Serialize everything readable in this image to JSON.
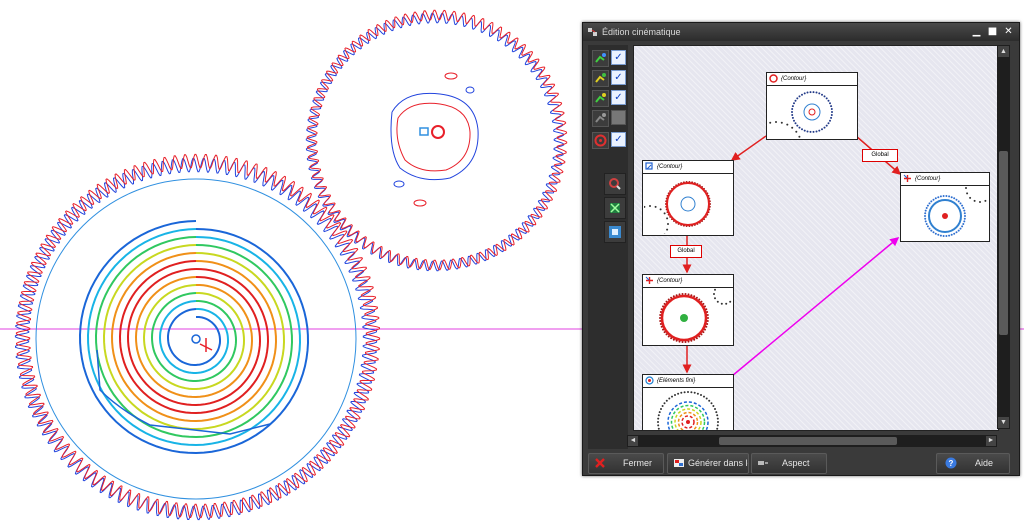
{
  "window": {
    "title": "Édition cinématique",
    "controls": {
      "minimize": "▁",
      "maximize": "■",
      "close": "✕"
    }
  },
  "sidebar": {
    "rows": [
      {
        "icon": "link-green-icon",
        "checked": true
      },
      {
        "icon": "link-yellow-icon",
        "checked": true
      },
      {
        "icon": "link-green-icon",
        "checked": true
      },
      {
        "icon": "link-grey-icon",
        "checked": false
      },
      {
        "icon": "gear-red-icon",
        "checked": true
      }
    ],
    "tools": [
      "zoom-icon",
      "fit-icon",
      "layout-icon"
    ],
    "check_glyph": "✓"
  },
  "graph": {
    "nodes": [
      {
        "id": "n1",
        "label": "{Contour}"
      },
      {
        "id": "n2",
        "label": "{Contour}"
      },
      {
        "id": "n3",
        "label": "{Contour}"
      },
      {
        "id": "n4",
        "label": "{Contour}"
      },
      {
        "id": "n5",
        "label": "{Eléments fini}"
      }
    ],
    "edge_labels": {
      "global_1": "Global",
      "global_2": "Global"
    },
    "colors": {
      "edge_red": "#e02020",
      "edge_magenta": "#ee00ee"
    }
  },
  "scrollbars": {
    "up": "▲",
    "down": "▼",
    "left": "◄",
    "right": "►"
  },
  "buttons": {
    "fermer": "Fermer",
    "generer": "Générer dans le",
    "aspect": "Aspect",
    "aide": "Aide"
  },
  "colors": {
    "gear_red": "#e8202a",
    "gear_blue": "#2244dd",
    "ring_blue": "#3090e0",
    "axis_magenta": "#e040e0",
    "spiral": [
      "#1a66d8",
      "#18b4e6",
      "#30c860",
      "#c8d820",
      "#f09018",
      "#e02020"
    ]
  }
}
